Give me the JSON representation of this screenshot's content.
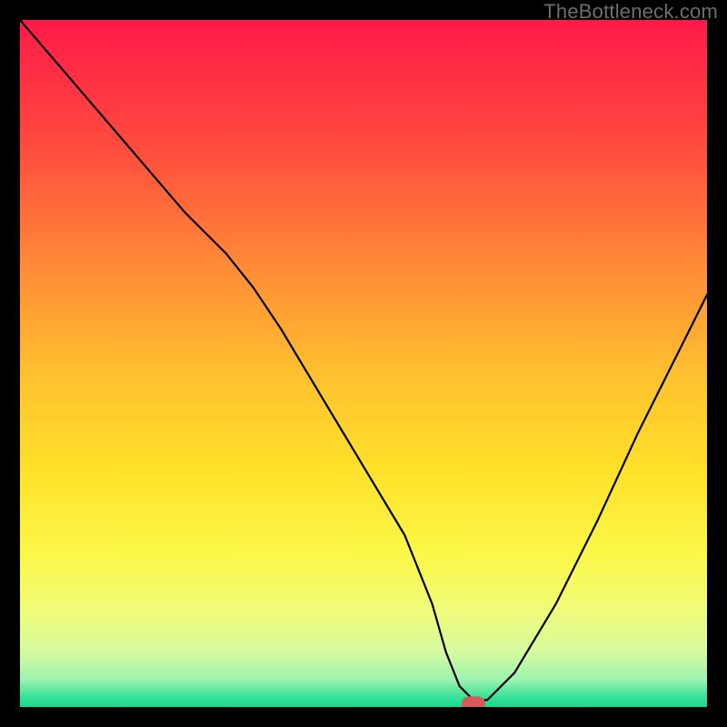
{
  "watermark": "TheBottleneck.com",
  "chart_data": {
    "type": "line",
    "title": "",
    "xlabel": "",
    "ylabel": "",
    "xlim": [
      0,
      100
    ],
    "ylim": [
      0,
      100
    ],
    "grid": false,
    "legend": false,
    "series": [
      {
        "name": "bottleneck-curve",
        "x": [
          0,
          6,
          12,
          18,
          24,
          30,
          34,
          38,
          44,
          50,
          56,
          60,
          62,
          64,
          66,
          68,
          72,
          78,
          84,
          90,
          96,
          100
        ],
        "y": [
          100,
          93,
          86,
          79,
          72,
          66,
          61,
          55,
          45,
          35,
          25,
          15,
          8,
          3,
          1,
          1,
          5,
          15,
          27,
          40,
          52,
          60
        ]
      }
    ],
    "marker": {
      "name": "optimum-marker",
      "x": 66,
      "y": 0.5,
      "color": "#d85a5d"
    },
    "background": {
      "type": "vertical-gradient",
      "stops": [
        {
          "pos": 0.0,
          "color": "#ff1a49"
        },
        {
          "pos": 0.18,
          "color": "#ff4a3e"
        },
        {
          "pos": 0.36,
          "color": "#ff8b37"
        },
        {
          "pos": 0.52,
          "color": "#ffc22f"
        },
        {
          "pos": 0.66,
          "color": "#ffe22a"
        },
        {
          "pos": 0.78,
          "color": "#fbf84a"
        },
        {
          "pos": 0.86,
          "color": "#f0fc7b"
        },
        {
          "pos": 0.92,
          "color": "#d6fba0"
        },
        {
          "pos": 0.96,
          "color": "#9cf4b0"
        },
        {
          "pos": 0.985,
          "color": "#39e29a"
        },
        {
          "pos": 1.0,
          "color": "#18d88f"
        }
      ]
    }
  }
}
